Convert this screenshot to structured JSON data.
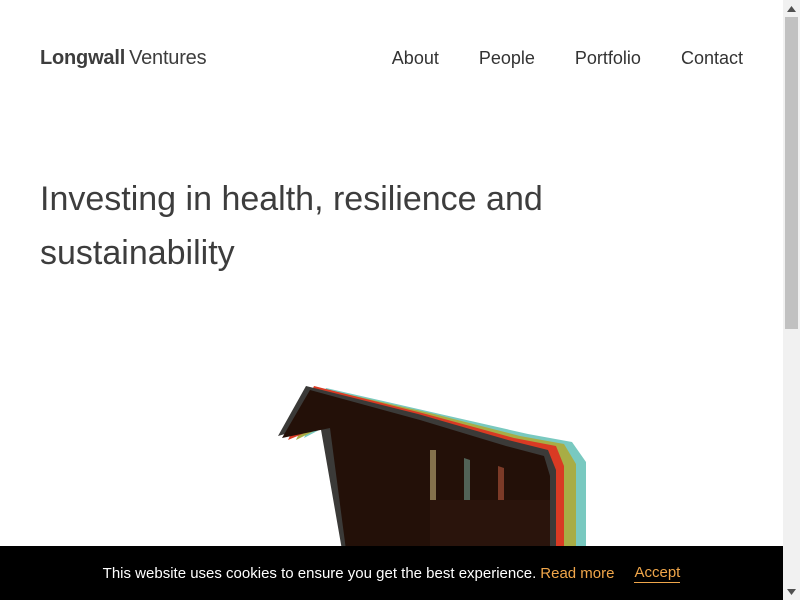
{
  "brand": {
    "name_bold": "Longwall",
    "name_light": "Ventures"
  },
  "nav": {
    "items": [
      "About",
      "People",
      "Portfolio",
      "Contact"
    ]
  },
  "hero": {
    "title": "Investing in health, resilience and sustainability"
  },
  "cookie": {
    "message": "This website uses cookies to ensure you get the best experience.",
    "read_more": "Read more",
    "accept": "Accept"
  },
  "colors": {
    "accent": "#f0a64a",
    "cookie_bg": "#000000",
    "text": "#3d3d3d",
    "art_dark": "#231008",
    "art_teal": "#79c9c0",
    "art_olive": "#a8ad45",
    "art_red": "#d93a23"
  },
  "icons": {
    "scroll_up": "triangle-up-icon",
    "scroll_down": "triangle-down-icon"
  }
}
